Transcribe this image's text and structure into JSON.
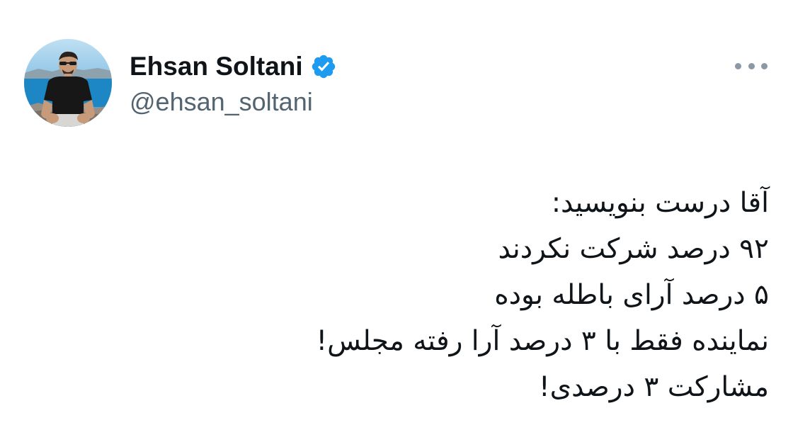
{
  "author": {
    "display_name": "Ehsan Soltani",
    "handle": "@ehsan_soltani",
    "verified": true,
    "verified_badge_color": "#1d9bf0"
  },
  "menu": {
    "more_icon": "more-horizontal-icon"
  },
  "tweet": {
    "lines": [
      "آقا درست بنویسید:",
      "۹۲ درصد شرکت نکردند",
      "۵ درصد آرای باطله بوده",
      "نماینده فقط با ۳ درصد آرا رفته مجلس!",
      "مشارکت ۳ درصدی!"
    ]
  }
}
